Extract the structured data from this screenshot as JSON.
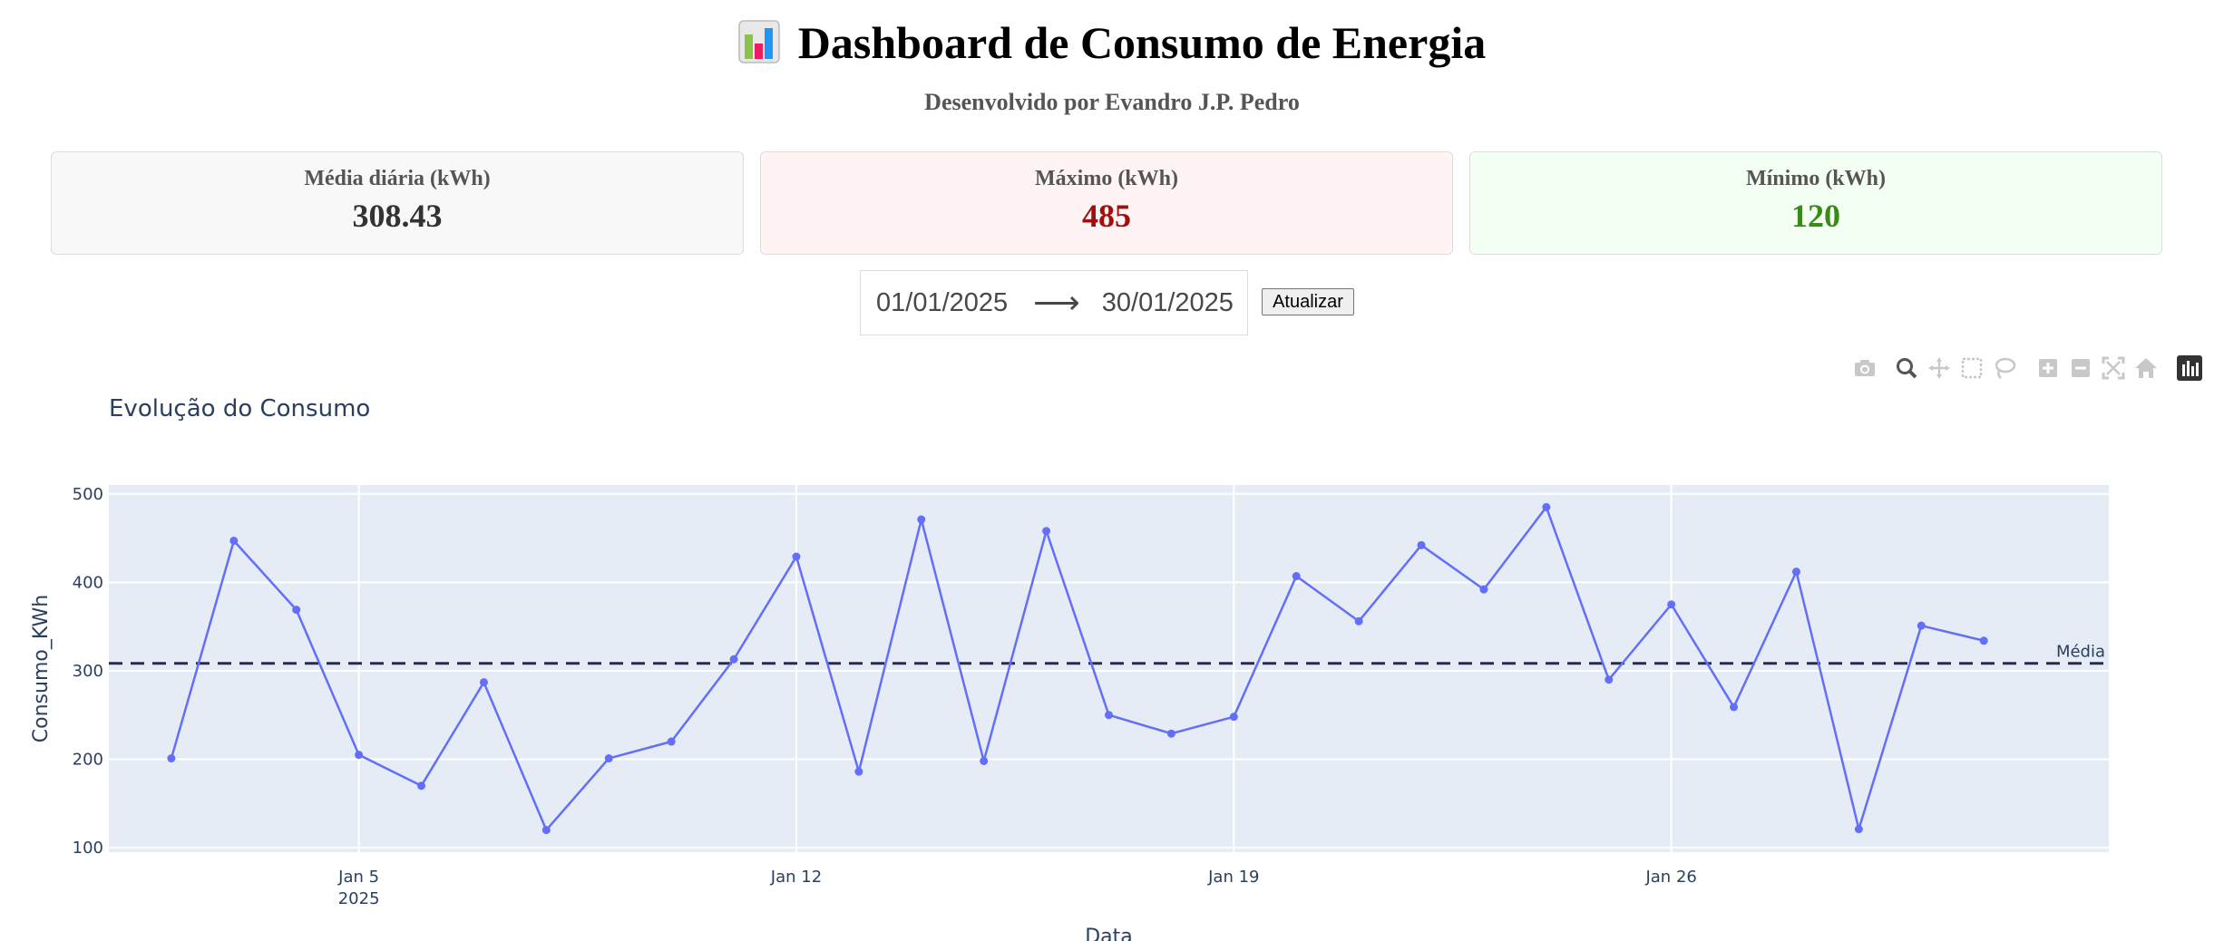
{
  "header": {
    "title": "Dashboard de Consumo de Energia",
    "subtitle": "Desenvolvido por Evandro J.P. Pedro",
    "icon": "bar-chart-icon"
  },
  "cards": {
    "avg": {
      "label": "Média diária (kWh)",
      "value": "308.43",
      "color": "#333333"
    },
    "max": {
      "label": "Máximo (kWh)",
      "value": "485",
      "color": "#a01010"
    },
    "min": {
      "label": "Mínimo (kWh)",
      "value": "120",
      "color": "#3a8a1a"
    }
  },
  "filter": {
    "start_date": "01/01/2025",
    "end_date": "30/01/2025",
    "button_label": "Atualizar"
  },
  "modebar": [
    "camera-icon",
    "zoom-icon",
    "pan-icon",
    "box-select-icon",
    "lasso-icon",
    "zoom-in-icon",
    "zoom-out-icon",
    "autoscale-icon",
    "reset-axes-icon",
    "plotly-logo-icon"
  ],
  "chart_data": {
    "type": "line",
    "title": "Evolução do Consumo",
    "xlabel": "Data",
    "ylabel": "Consumo_KWh",
    "x": [
      "2025-01-02",
      "2025-01-03",
      "2025-01-04",
      "2025-01-05",
      "2025-01-06",
      "2025-01-07",
      "2025-01-08",
      "2025-01-09",
      "2025-01-10",
      "2025-01-11",
      "2025-01-12",
      "2025-01-13",
      "2025-01-14",
      "2025-01-15",
      "2025-01-16",
      "2025-01-17",
      "2025-01-18",
      "2025-01-19",
      "2025-01-20",
      "2025-01-21",
      "2025-01-22",
      "2025-01-23",
      "2025-01-24",
      "2025-01-25",
      "2025-01-26",
      "2025-01-27",
      "2025-01-28",
      "2025-01-29",
      "2025-01-30",
      "2025-01-31"
    ],
    "x_tick_labels": [
      "Jan 5",
      "Jan 12",
      "Jan 19",
      "Jan 26"
    ],
    "x_tick_dates": [
      "2025-01-05",
      "2025-01-12",
      "2025-01-19",
      "2025-01-26"
    ],
    "x_year_label": "2025",
    "xlim": [
      "2025-01-01",
      "2025-02-02"
    ],
    "y_ticks": [
      100,
      200,
      300,
      400,
      500
    ],
    "ylim": [
      95,
      510
    ],
    "series": [
      {
        "values": [
          201,
          447,
          369,
          205,
          170,
          287,
          120,
          201,
          220,
          313,
          429,
          186,
          471,
          198,
          458,
          250,
          229,
          248,
          407,
          356,
          442,
          392,
          485,
          290,
          375,
          259,
          412,
          121,
          351,
          334
        ],
        "color": "#636efa"
      }
    ],
    "reference_line": {
      "value": 308.43,
      "label": "Média",
      "style": "dashed",
      "color": "#2a2a4a"
    },
    "grid": true,
    "plot_bg": "#e5ecf6"
  }
}
